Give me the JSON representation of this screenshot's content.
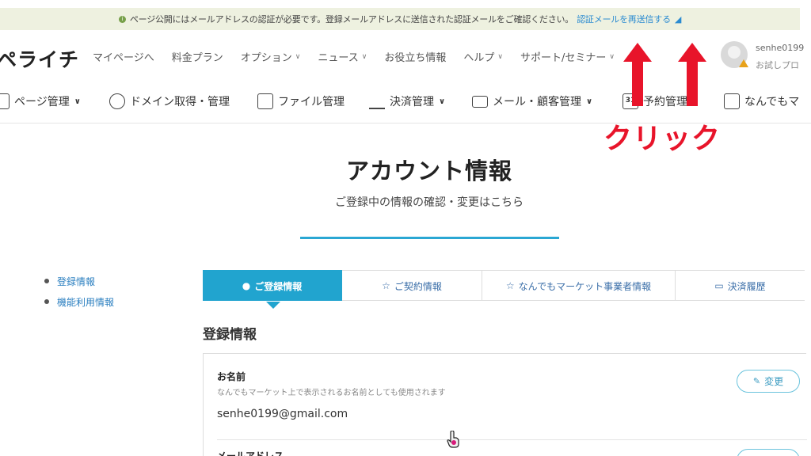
{
  "notice": {
    "message": "ページ公開にはメールアドレスの認証が必要です。登録メールアドレスに送信された認証メールをご確認ください。",
    "resend_link": "認証メールを再送信する"
  },
  "header": {
    "logo": "ペライチ",
    "nav": [
      {
        "label": "マイページへ",
        "dropdown": false
      },
      {
        "label": "料金プラン",
        "dropdown": false
      },
      {
        "label": "オプション",
        "dropdown": true
      },
      {
        "label": "ニュース",
        "dropdown": true
      },
      {
        "label": "お役立ち情報",
        "dropdown": false
      },
      {
        "label": "ヘルプ",
        "dropdown": true
      },
      {
        "label": "サポート/セミナー",
        "dropdown": true
      }
    ],
    "user_name": "senhe0199",
    "user_plan": "お試しプロ"
  },
  "management": [
    {
      "label": "ページ管理",
      "icon": "page-icon",
      "dropdown": true
    },
    {
      "label": "ドメイン取得・管理",
      "icon": "globe-icon",
      "dropdown": false
    },
    {
      "label": "ファイル管理",
      "icon": "file-icon",
      "dropdown": false
    },
    {
      "label": "決済管理",
      "icon": "cart-icon",
      "dropdown": true
    },
    {
      "label": "メール・顧客管理",
      "icon": "mail-icon",
      "dropdown": true
    },
    {
      "label": "予約管理",
      "icon": "calendar-icon",
      "dropdown": true
    },
    {
      "label": "なんでもマ",
      "icon": "shop-icon",
      "dropdown": false
    }
  ],
  "calendar_day": "31",
  "annotation": {
    "text": "クリック",
    "color": "#e8142a"
  },
  "page": {
    "title": "アカウント情報",
    "subtitle": "ご登録中の情報の確認・変更はこちら"
  },
  "side_links": [
    "登録情報",
    "機能利用情報"
  ],
  "tabs": [
    {
      "label": "ご登録情報",
      "icon": "user-icon",
      "active": true
    },
    {
      "label": "ご契約情報",
      "icon": "star-icon",
      "active": false
    },
    {
      "label": "なんでもマーケット事業者情報",
      "icon": "star-icon",
      "active": false
    },
    {
      "label": "決済履歴",
      "icon": "card-icon",
      "active": false
    }
  ],
  "section_title": "登録情報",
  "fields": [
    {
      "label": "お名前",
      "description": "なんでもマーケット上で表示されるお名前としても使用されます",
      "value": "senhe0199@gmail.com",
      "button": "変更"
    },
    {
      "label": "メールアドレス"
    }
  ],
  "colors": {
    "accent": "#21a4cf",
    "notice_bg": "#eef1e0",
    "link": "#2b8bd1",
    "annotation": "#e8142a"
  }
}
